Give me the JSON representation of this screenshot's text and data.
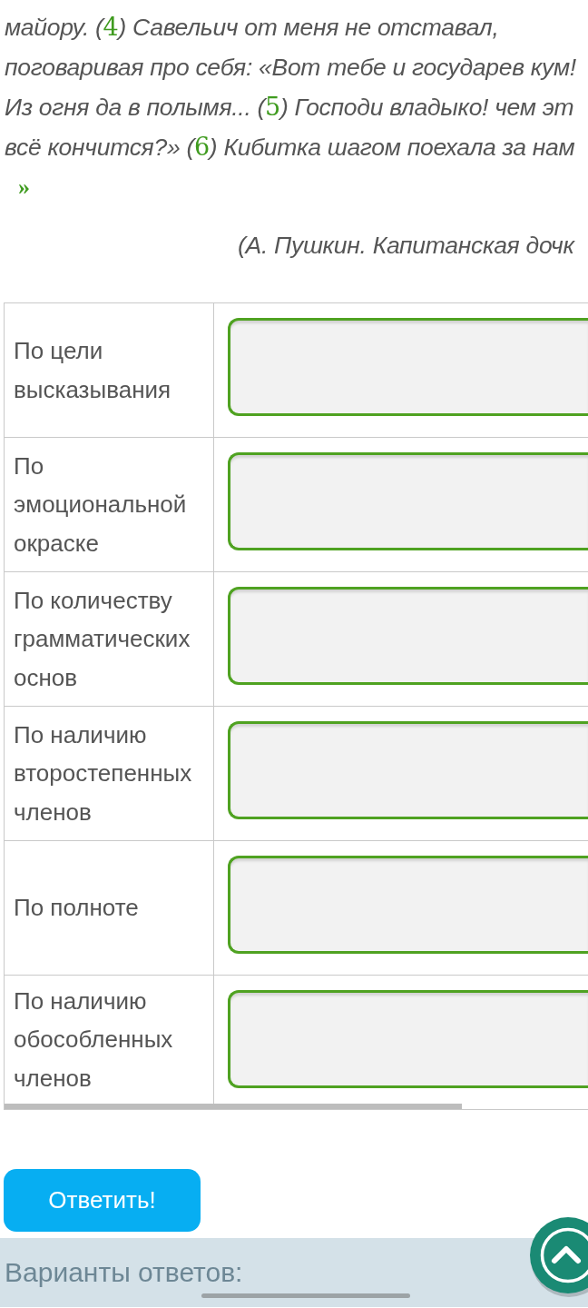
{
  "passage": {
    "lines": [
      [
        {
          "kind": "text",
          "text": "майору. ("
        },
        {
          "kind": "number",
          "text": "4"
        },
        {
          "kind": "text",
          "text": ") Савельич от меня не отставал,"
        }
      ],
      [
        {
          "kind": "text",
          "text": "поговаривая про себя: «Вот тебе и государев кум!"
        }
      ],
      [
        {
          "kind": "text",
          "text": "Из огня да в полымя... ("
        },
        {
          "kind": "number",
          "text": "5"
        },
        {
          "kind": "text",
          "text": ") Господи владыко! чем эт"
        }
      ],
      [
        {
          "kind": "text",
          "text": "всё кончится?» ("
        },
        {
          "kind": "number",
          "text": "6"
        },
        {
          "kind": "text",
          "text": ") Кибитка шагом поехала за нам"
        }
      ]
    ],
    "closing_mark": "»",
    "attribution": "(А. Пушкин. Капитанская дочк"
  },
  "table": {
    "rows": [
      {
        "label": "По цели\nвысказывания"
      },
      {
        "label": "По\nэмоциональной\nокраске"
      },
      {
        "label": "По количеству\nграмматических\nоснов"
      },
      {
        "label": "По наличию\nвторостепенных\nчленов"
      },
      {
        "label": "По полноте"
      },
      {
        "label": "По наличию\nобособленных\nчленов"
      }
    ]
  },
  "submit_button": {
    "label": "Ответить!"
  },
  "answers_panel": {
    "title": "Варианты ответов:"
  }
}
